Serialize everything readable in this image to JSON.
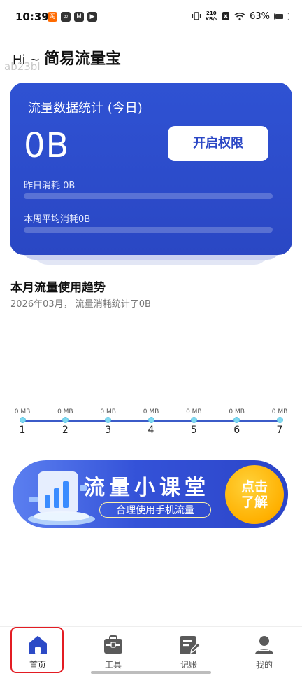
{
  "status_bar": {
    "time": "10:39",
    "app_icons": [
      "淘",
      "∞",
      "M",
      "▶"
    ],
    "net_speed_top": "210",
    "net_speed_bottom": "KB/s",
    "battery": "63%",
    "battery_level": 0.63
  },
  "header": {
    "greeting": "Hi ~ ",
    "title": "简易流量宝",
    "subtitle": "ab23bl"
  },
  "card": {
    "title": "流量数据统计 (今日)",
    "today_value": "0B",
    "permission_button": "开启权限",
    "yesterday_label": "昨日消耗 0B",
    "week_avg_label": "本周平均消耗0B",
    "yesterday_fraction": 0,
    "week_avg_fraction": 0
  },
  "trend": {
    "title": "本月流量使用趋势",
    "subtitle": "2026年03月， 流量消耗统计了0B"
  },
  "chart_data": {
    "type": "line",
    "x": [
      "1",
      "2",
      "3",
      "4",
      "5",
      "6",
      "7"
    ],
    "series": [
      {
        "values": [
          0,
          0,
          0,
          0,
          0,
          0,
          0
        ],
        "labels": [
          "0 MB",
          "0 MB",
          "0 MB",
          "0 MB",
          "0 MB",
          "0 MB",
          "0 MB"
        ]
      }
    ],
    "title": "",
    "xlabel": "",
    "ylabel": "",
    "color": "#3b5bc8"
  },
  "banner": {
    "title": "流量小课堂",
    "subtitle": "合理使用手机流量",
    "cta": "点击了解"
  },
  "tabs": [
    {
      "label": "首页",
      "icon": "home-icon",
      "active": true
    },
    {
      "label": "工具",
      "icon": "toolbox-icon",
      "active": false
    },
    {
      "label": "记账",
      "icon": "notebook-edit-icon",
      "active": false
    },
    {
      "label": "我的",
      "icon": "user-icon",
      "active": false
    }
  ],
  "colors": {
    "primary": "#2c4ac6",
    "accent_orange": "#ffb000",
    "active_highlight": "#e31c23"
  }
}
